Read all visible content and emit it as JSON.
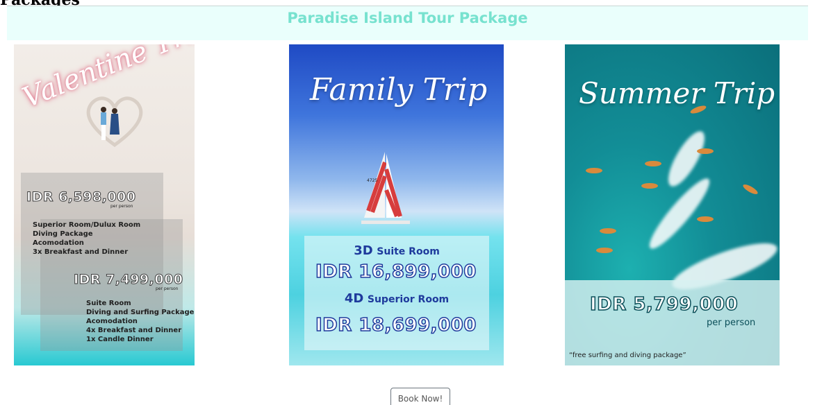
{
  "page": {
    "top_clipped_text": "Packages"
  },
  "header": {
    "title": "Paradise Island Tour Package"
  },
  "cards": [
    {
      "script_title": "Valentine Trip",
      "offers": [
        {
          "price": "IDR 6,598,000",
          "per": "per person",
          "items": [
            "Superior Room/Dulux Room",
            "Diving Package",
            "Acomodation",
            "3x Breakfast and Dinner"
          ]
        },
        {
          "price": "IDR 7,499,000",
          "per": "per person",
          "items": [
            "Suite Room",
            "Diving and Surfing Package",
            "Acomodation",
            "4x Breakfast and Dinner",
            "1x Candle Dinner"
          ]
        }
      ]
    },
    {
      "script_title": "Family Trip",
      "sail_number": "4725",
      "offers": [
        {
          "num": "3D",
          "label": "Suite Room",
          "price": "IDR 16,899,000"
        },
        {
          "num": "4D",
          "label": "Superior Room",
          "price": "IDR 18,699,000"
        }
      ]
    },
    {
      "script_title": "Summer Trip",
      "price": "IDR 5,799,000",
      "per": "per person",
      "note": "“free surfing and diving package”"
    }
  ],
  "actions": {
    "book_label": "Book Now!"
  },
  "colors": {
    "title": "#77e2cf",
    "title_bg": "#eafffc",
    "room_label": "#1e3a9c"
  }
}
